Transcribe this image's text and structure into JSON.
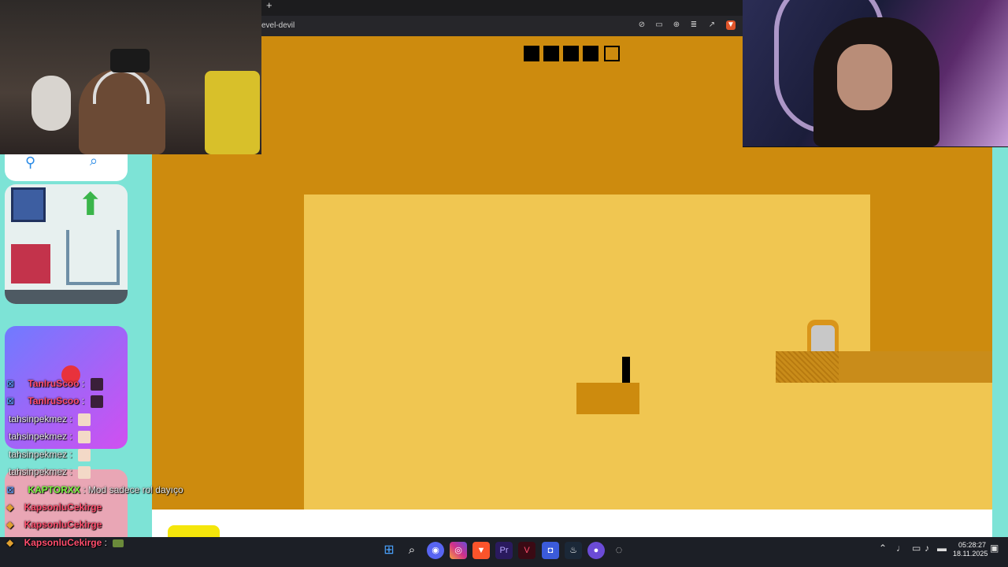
{
  "browser": {
    "new_tab_label": "+",
    "url": "evel-devil",
    "toolbar_icons": [
      "eye-off-icon",
      "cast-icon",
      "zoom-icon",
      "reader-icon",
      "share-icon",
      "brave-shield-icon"
    ]
  },
  "game": {
    "level_progress": {
      "completed": 4,
      "total": 5
    }
  },
  "chat": {
    "messages": [
      {
        "user": "TanIruScoo",
        "text": ":",
        "user_color": "#ff4d6d"
      },
      {
        "user": "TanIruScoo",
        "text": ":",
        "user_color": "#ff4d6d"
      },
      {
        "user": "tahsinpekmez",
        "text": ":",
        "user_color": "#e8e8e8"
      },
      {
        "user": "tahsinpekmez",
        "text": ":",
        "user_color": "#e8e8e8"
      },
      {
        "user": "tahsinpekmez",
        "text": ":",
        "user_color": "#e8e8e8"
      },
      {
        "user": "tahsinpekmez",
        "text": ":",
        "user_color": "#e8e8e8"
      },
      {
        "user": "KAPTORXX",
        "text": ": Mod sadece rol dayıço",
        "user_color": "#7cf542"
      },
      {
        "user": "KapsonluCekirge",
        "text": "",
        "user_color": "#ff4d6d"
      },
      {
        "user": "KapsonluCekirge",
        "text": "",
        "user_color": "#ff4d6d"
      },
      {
        "user": "KapsonluCekirge",
        "text": ":",
        "user_color": "#ff4d6d"
      }
    ]
  },
  "taskbar": {
    "apps": [
      "windows-start-icon",
      "search-icon",
      "discord-icon",
      "instagram-icon",
      "brave-icon",
      "premiere-icon",
      "vegas-icon",
      "app-icon",
      "steam-icon",
      "obs-icon",
      "chrome-icon"
    ],
    "time": "05:28:27",
    "date": "18.11.2025"
  },
  "colors": {
    "game_outer": "#cd8b0e",
    "game_room": "#f0c651",
    "sidebar": "#7de3d6"
  }
}
